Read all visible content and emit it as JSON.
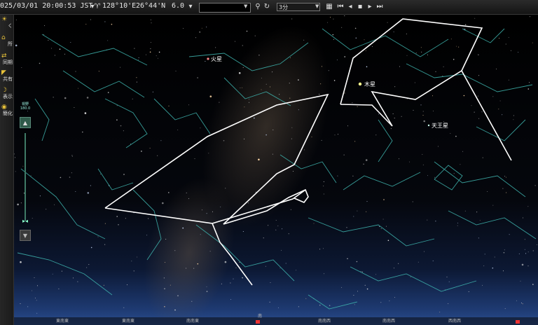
{
  "toolbar": {
    "datetime": "025/03/01 20:00:53 JST",
    "longitude": "128°10'E",
    "latitude": "26°44'N",
    "magnitude": "6.0",
    "interval": "3分",
    "icons": [
      "dropdown-icon",
      "telescope-icon",
      "search-icon",
      "refresh-icon",
      "calendar-icon",
      "skip-back-icon",
      "step-back-icon",
      "stop-icon",
      "play-icon",
      "skip-forward-icon"
    ]
  },
  "left_panel": {
    "items": [
      {
        "label": "く",
        "icon": "sun-icon"
      },
      {
        "label": "所",
        "icon": "location-icon"
      },
      {
        "label": "同期",
        "icon": "sync-icon"
      },
      {
        "label": "共有",
        "icon": "share-icon"
      },
      {
        "label": "表示",
        "icon": "moon-icon"
      },
      {
        "label": "簡化",
        "icon": "eye-icon"
      }
    ],
    "fov_label": "視野",
    "fov_value": "180.0"
  },
  "sky": {
    "labels": [
      {
        "text": "火星",
        "color": "#ffffff"
      },
      {
        "text": "木星",
        "color": "#ffffff"
      },
      {
        "text": "天王星",
        "color": "#ffffff"
      }
    ],
    "directions": [
      "東南東",
      "東南東",
      "南南東",
      "南",
      "南南西",
      "南南西",
      "西南西",
      "西南西"
    ]
  },
  "colors": {
    "constellation_line": "#3fb6b0",
    "asterism_line": "#ffffff",
    "horizon_glow": "#23407a",
    "direction_mark": "#e33333",
    "accent": "#e8c23a"
  }
}
